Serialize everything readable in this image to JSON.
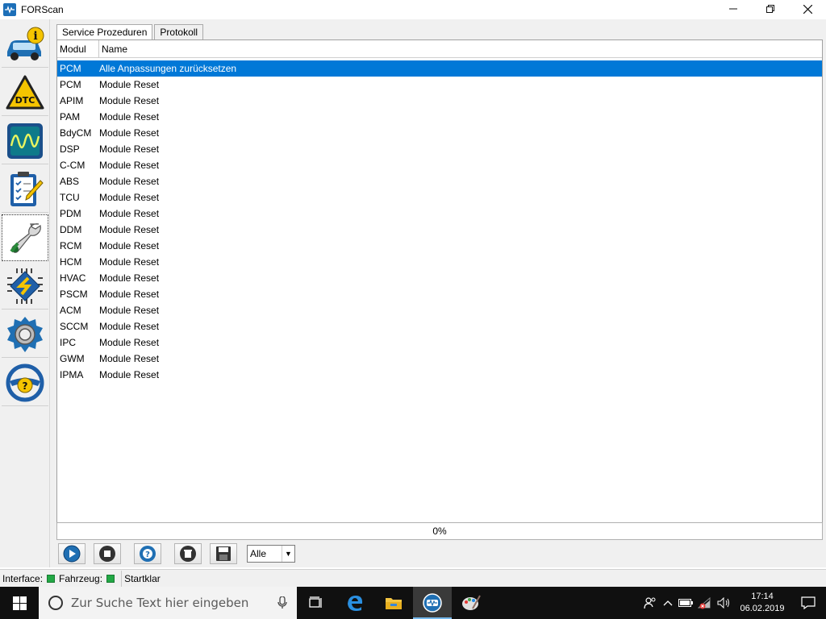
{
  "window": {
    "title": "FORScan",
    "min_icon": "minimize-icon",
    "restore_icon": "restore-icon",
    "close_icon": "close-icon"
  },
  "sidebar": {
    "items": [
      {
        "icon": "vehicle-info-icon",
        "active": false
      },
      {
        "icon": "dtc-icon",
        "active": false
      },
      {
        "icon": "oscilloscope-icon",
        "active": false
      },
      {
        "icon": "checklist-icon",
        "active": false
      },
      {
        "icon": "wrench-icon",
        "active": true
      },
      {
        "icon": "chip-icon",
        "active": false
      },
      {
        "icon": "settings-gear-icon",
        "active": false
      },
      {
        "icon": "help-steering-wheel-icon",
        "active": false
      }
    ]
  },
  "tabs": [
    {
      "label": "Service Prozeduren",
      "active": true
    },
    {
      "label": "Protokoll",
      "active": false
    }
  ],
  "table": {
    "columns": [
      "Modul",
      "Name"
    ],
    "selected_index": 0,
    "rows": [
      {
        "modul": "PCM",
        "name": "Alle Anpassungen zurücksetzen"
      },
      {
        "modul": "PCM",
        "name": "Module Reset"
      },
      {
        "modul": "APIM",
        "name": "Module Reset"
      },
      {
        "modul": "PAM",
        "name": "Module Reset"
      },
      {
        "modul": "BdyCM",
        "name": "Module Reset"
      },
      {
        "modul": "DSP",
        "name": "Module Reset"
      },
      {
        "modul": "C-CM",
        "name": "Module Reset"
      },
      {
        "modul": "ABS",
        "name": "Module Reset"
      },
      {
        "modul": "TCU",
        "name": "Module Reset"
      },
      {
        "modul": "PDM",
        "name": "Module Reset"
      },
      {
        "modul": "DDM",
        "name": "Module Reset"
      },
      {
        "modul": "RCM",
        "name": "Module Reset"
      },
      {
        "modul": "HCM",
        "name": "Module Reset"
      },
      {
        "modul": "HVAC",
        "name": "Module Reset"
      },
      {
        "modul": "PSCM",
        "name": "Module Reset"
      },
      {
        "modul": "ACM",
        "name": "Module Reset"
      },
      {
        "modul": "SCCM",
        "name": "Module Reset"
      },
      {
        "modul": "IPC",
        "name": "Module Reset"
      },
      {
        "modul": "GWM",
        "name": "Module Reset"
      },
      {
        "modul": "IPMA",
        "name": "Module Reset"
      }
    ]
  },
  "progress": {
    "value_percent": 0,
    "label": "0%"
  },
  "toolbar": {
    "buttons": [
      "play-icon",
      "stop-icon",
      "help-lifebuoy-icon",
      "delete-icon",
      "save-icon"
    ],
    "filter_value": "Alle"
  },
  "statusbar": {
    "interface_label": "Interface:",
    "vehicle_label": "Fahrzeug:",
    "status_text": "Startklar",
    "led_color": "#22a845"
  },
  "taskbar": {
    "search_placeholder": "Zur Suche Text hier eingeben",
    "time": "17:14",
    "date": "06.02.2019",
    "accent": "#76b9ed"
  }
}
